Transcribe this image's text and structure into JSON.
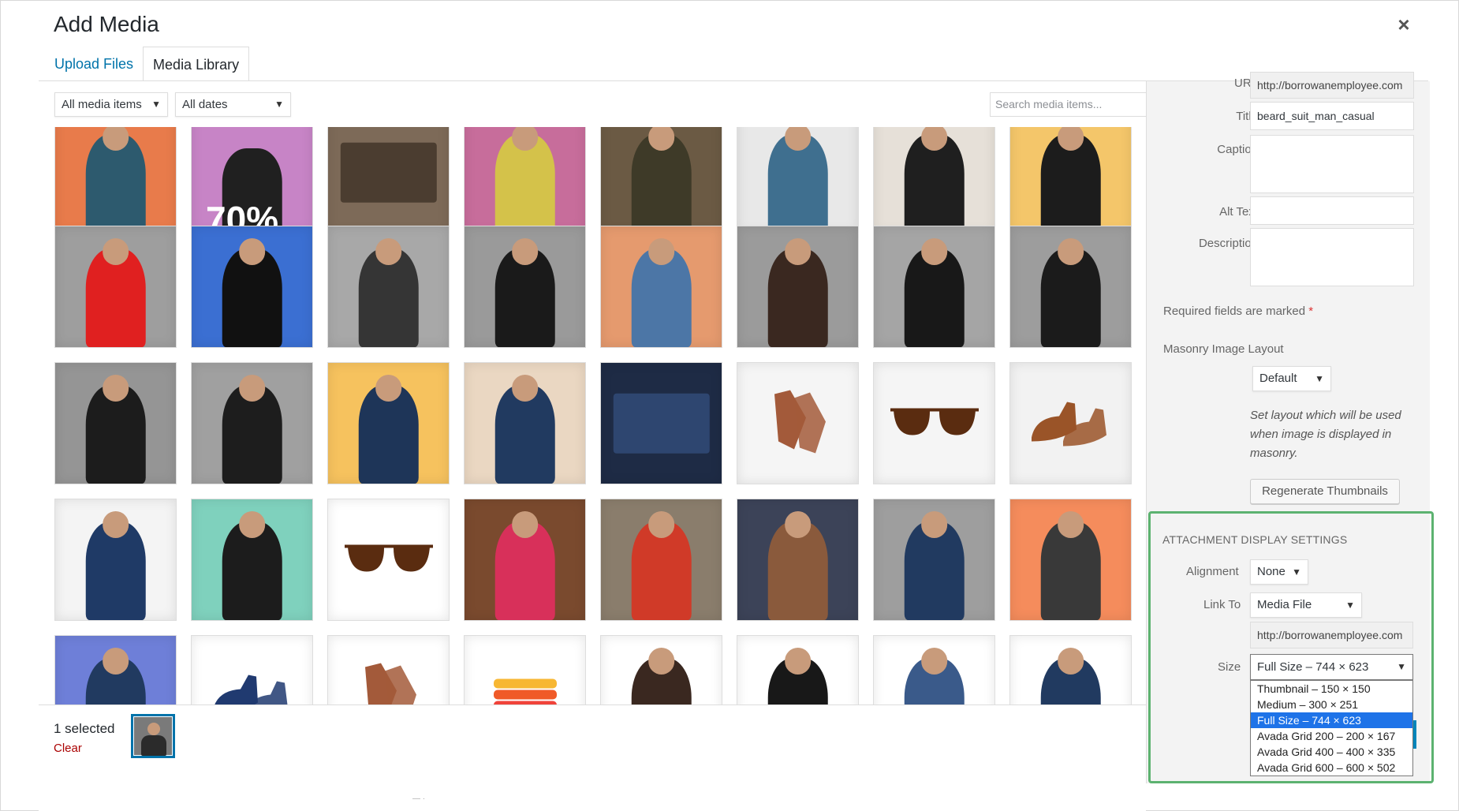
{
  "modal": {
    "title": "Add Media",
    "close_glyph": "×"
  },
  "tabs": [
    {
      "label": "Upload Files"
    },
    {
      "label": "Media Library"
    }
  ],
  "toolbar": {
    "filter_type": "All media items",
    "filter_date": "All dates",
    "search_placeholder": "Search media items..."
  },
  "grid_items": [
    {
      "bg": "#e87b4b",
      "kind": "person",
      "fig": "#2d5a6e"
    },
    {
      "bg": "#c784c6",
      "kind": "text",
      "text": "70%",
      "fig": "#202020"
    },
    {
      "bg": "#7d6a58",
      "kind": "plain",
      "fig": "#4b3d30"
    },
    {
      "bg": "#c76d9b",
      "kind": "person",
      "fig": "#d4c24a"
    },
    {
      "bg": "#6b5a44",
      "kind": "person",
      "fig": "#3e3a28"
    },
    {
      "bg": "#e8e8e8",
      "kind": "person",
      "fig": "#3f6f8f"
    },
    {
      "bg": "#e6e0d8",
      "kind": "person",
      "fig": "#1f1f1f"
    },
    {
      "bg": "#f4c66a",
      "kind": "person",
      "fig": "#1c1c1c"
    },
    {
      "bg": "#9e9e9e",
      "kind": "person",
      "fig": "#e02020"
    },
    {
      "bg": "#3b6fd2",
      "kind": "person",
      "fig": "#111111"
    },
    {
      "bg": "#a8a8a8",
      "kind": "person",
      "fig": "#353535"
    },
    {
      "bg": "#9a9a9a",
      "kind": "person",
      "fig": "#1a1a1a"
    },
    {
      "bg": "#e59a6e",
      "kind": "person",
      "fig": "#4c76a6"
    },
    {
      "bg": "#9b9b9b",
      "kind": "person",
      "fig": "#3a2820"
    },
    {
      "bg": "#a5a5a5",
      "kind": "person",
      "fig": "#181818"
    },
    {
      "bg": "#9d9d9d",
      "kind": "person",
      "fig": "#1b1b1b"
    },
    {
      "bg": "#959595",
      "kind": "person",
      "fig": "#1c1c1c"
    },
    {
      "bg": "#a0a0a0",
      "kind": "person",
      "fig": "#1d1d1d"
    },
    {
      "bg": "#f6c25e",
      "kind": "person",
      "fig": "#1e3558"
    },
    {
      "bg": "#ead7c2",
      "kind": "person",
      "fig": "#213a60"
    },
    {
      "bg": "#1e2b45",
      "kind": "plain",
      "fig": "#2e4670"
    },
    {
      "bg": "#f5f5f5",
      "kind": "gloves",
      "fig": "#a35a3a"
    },
    {
      "bg": "#f5f5f5",
      "kind": "glasses",
      "fig": "#5a2c10"
    },
    {
      "bg": "#f2f2f2",
      "kind": "shoes",
      "fig": "#9a5428"
    },
    {
      "bg": "#f4f4f4",
      "kind": "person",
      "fig": "#1f3a66"
    },
    {
      "bg": "#7fd1bd",
      "kind": "person",
      "fig": "#1c1c1c"
    },
    {
      "bg": "#ffffff",
      "kind": "glasses",
      "fig": "#5a2c10"
    },
    {
      "bg": "#7a4a2e",
      "kind": "person",
      "fig": "#d8305a"
    },
    {
      "bg": "#8a7d6c",
      "kind": "person",
      "fig": "#d03a28"
    },
    {
      "bg": "#3c4358",
      "kind": "person",
      "fig": "#8a5a3c"
    },
    {
      "bg": "#9e9e9e",
      "kind": "person",
      "fig": "#213a60"
    },
    {
      "bg": "#f58c5c",
      "kind": "person",
      "fig": "#393939"
    },
    {
      "bg": "#6e7fd8",
      "kind": "person",
      "fig": "#213a60"
    },
    {
      "bg": "#ffffff",
      "kind": "shoes",
      "fig": "#203a70"
    },
    {
      "bg": "#ffffff",
      "kind": "gloves",
      "fig": "#a35a3a"
    },
    {
      "bg": "#ffffff",
      "kind": "stack",
      "fig": "#f05a28"
    },
    {
      "bg": "#ffffff",
      "kind": "person",
      "fig": "#3a2820"
    },
    {
      "bg": "#ffffff",
      "kind": "person",
      "fig": "#181818"
    },
    {
      "bg": "#ffffff",
      "kind": "person",
      "fig": "#3a5a8a"
    },
    {
      "bg": "#ffffff",
      "kind": "person",
      "fig": "#213a60"
    }
  ],
  "selection": {
    "count_label": "1 selected",
    "clear_label": "Clear"
  },
  "details": {
    "url_label": "URL",
    "url_value": "http://borrowanemployee.com",
    "title_label": "Title",
    "title_value": "beard_suit_man_casual",
    "caption_label": "Caption",
    "alt_label": "Alt Text",
    "description_label": "Description",
    "required_note": "Required fields are marked",
    "required_star": "*",
    "masonry_label": "Masonry Image Layout",
    "masonry_value": "Default",
    "masonry_note": "Set layout which will be used when image is displayed in masonry.",
    "regenerate_label": "Regenerate Thumbnails"
  },
  "display_settings": {
    "title": "ATTACHMENT DISPLAY SETTINGS",
    "alignment_label": "Alignment",
    "alignment_value": "None",
    "link_label": "Link To",
    "link_value": "Media File",
    "link_url": "http://borrowanemployee.com",
    "size_label": "Size",
    "size_value": "Full Size – 744 × 623",
    "size_options": [
      "Thumbnail – 150 × 150",
      "Medium – 300 × 251",
      "Full Size – 744 × 623",
      "Avada Grid 200 – 200 × 167",
      "Avada Grid 400 – 400 × 335",
      "Avada Grid 600 – 600 × 502"
    ],
    "selected_index": 2
  },
  "colors": {
    "link": "#0073aa",
    "highlight": "#5cb270",
    "option_selected": "#1e73e8",
    "danger": "#a00"
  }
}
